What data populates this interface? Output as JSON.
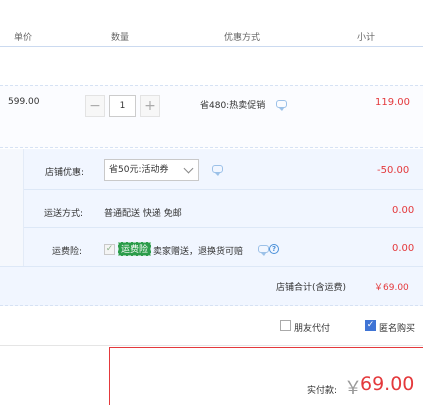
{
  "header": {
    "col_unit_price": "单价",
    "col_quantity": "数量",
    "col_discount": "优惠方式",
    "col_subtotal": "小计"
  },
  "item": {
    "unit_price": "599.00",
    "quantity": "1",
    "minus": "−",
    "plus": "+",
    "promo": "省480:热卖促销",
    "subtotal": "119.00"
  },
  "shop": {
    "discount_label": "店铺优惠:",
    "discount_select": "省50元:活动券",
    "discount_amount": "-50.00",
    "shipping_label": "运送方式:",
    "shipping_value": "普通配送 快递 免邮",
    "shipping_amount": "0.00",
    "insurance_label": "运费险:",
    "insurance_badge": "运费险",
    "insurance_text": "卖家赠送，退换货可赔",
    "insurance_amount": "0.00",
    "help_glyph": "?",
    "total_label": "店铺合计(含运费)",
    "total_amount": "￥69.00"
  },
  "options": {
    "friend_pay": "朋友代付",
    "anonymous": "匿名购买",
    "check_glyph": "✓"
  },
  "payment": {
    "label": "实付款:",
    "currency": "￥",
    "amount": "69.00"
  },
  "colors": {
    "accent_red": "#e4393c",
    "link_blue": "#3f74d5",
    "badge_green": "#2b9c4a"
  }
}
